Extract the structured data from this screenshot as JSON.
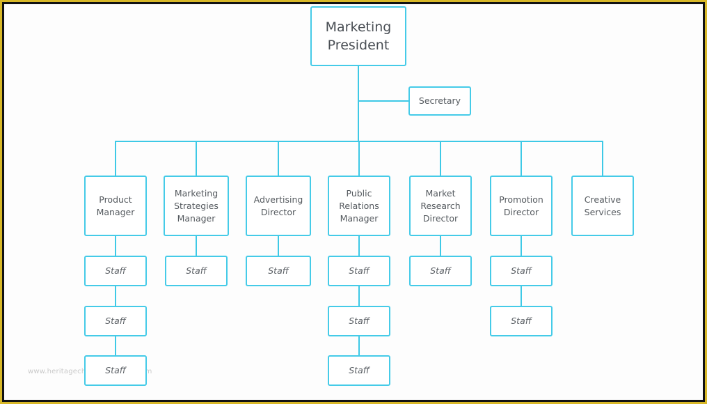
{
  "chart": {
    "president": "Marketing\nPresident",
    "secretary": "Secretary",
    "departments": [
      {
        "title": "Product\nManager",
        "staff": [
          "Staff",
          "Staff",
          "Staff"
        ]
      },
      {
        "title": "Marketing\nStrategies\nManager",
        "staff": [
          "Staff"
        ]
      },
      {
        "title": "Advertising\nDirector",
        "staff": [
          "Staff"
        ]
      },
      {
        "title": "Public\nRelations\nManager",
        "staff": [
          "Staff",
          "Staff",
          "Staff"
        ]
      },
      {
        "title": "Market\nResearch\nDirector",
        "staff": [
          "Staff"
        ]
      },
      {
        "title": "Promotion\nDirector",
        "staff": [
          "Staff",
          "Staff"
        ]
      },
      {
        "title": "Creative\nServices",
        "staff": []
      }
    ]
  },
  "watermark": "www.heritagechristiancollege.com",
  "colors": {
    "accent": "#45cbe8",
    "frame_outer": "#d8b828",
    "frame_inner": "#111111"
  }
}
